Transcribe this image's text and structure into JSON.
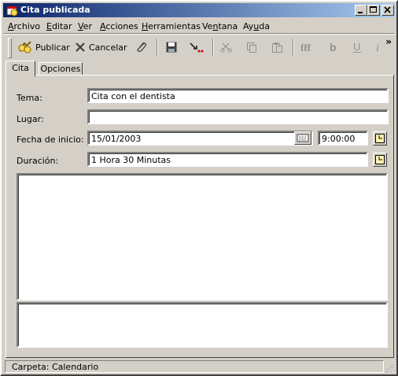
{
  "window": {
    "title": "Cita publicada"
  },
  "menu": [
    {
      "label_acc": "A",
      "label_rest": "rchivo"
    },
    {
      "label_acc": "E",
      "label_rest": "ditar"
    },
    {
      "label_acc": "V",
      "label_rest": "er"
    },
    {
      "label_acc": "A",
      "label_rest": "cciones"
    },
    {
      "label_acc": "H",
      "label_rest": "erramientas"
    },
    {
      "label_pre": "Ve",
      "label_acc": "n",
      "label_rest": "tana"
    },
    {
      "label_pre": "Ay",
      "label_acc": "u",
      "label_rest": "da"
    }
  ],
  "toolbar": {
    "publish_label": "Publicar",
    "cancel_label": "Cancelar",
    "overflow_glyph": "»"
  },
  "tabs": [
    "Cita",
    "Opciones"
  ],
  "form": {
    "tema_label": "Tema:",
    "tema_value": "Cita con el dentista",
    "lugar_label": "Lugar:",
    "lugar_value": "",
    "fecha_label": "Fecha de inicio:",
    "fecha_value": "15/01/2003",
    "hora_value": "9:00:00",
    "duracion_label": "Duración:",
    "duracion_value": "1 Hora 30 Minutas"
  },
  "status": {
    "folder": "Carpeta: Calendario"
  },
  "colors": {
    "title_start": "#0a246a",
    "title_end": "#a6caf0",
    "face": "#d4d0c8"
  },
  "icons": [
    "calendar-app-icon",
    "minimize-icon",
    "maximize-icon",
    "close-icon",
    "publish-icon",
    "cancel-icon",
    "attach-icon",
    "save-icon",
    "move-icon",
    "cut-icon",
    "copy-icon",
    "paste-icon",
    "font-icon",
    "bold-icon",
    "underline-icon",
    "italic-icon",
    "date-picker-icon",
    "clock-icon",
    "resize-grip-icon"
  ]
}
